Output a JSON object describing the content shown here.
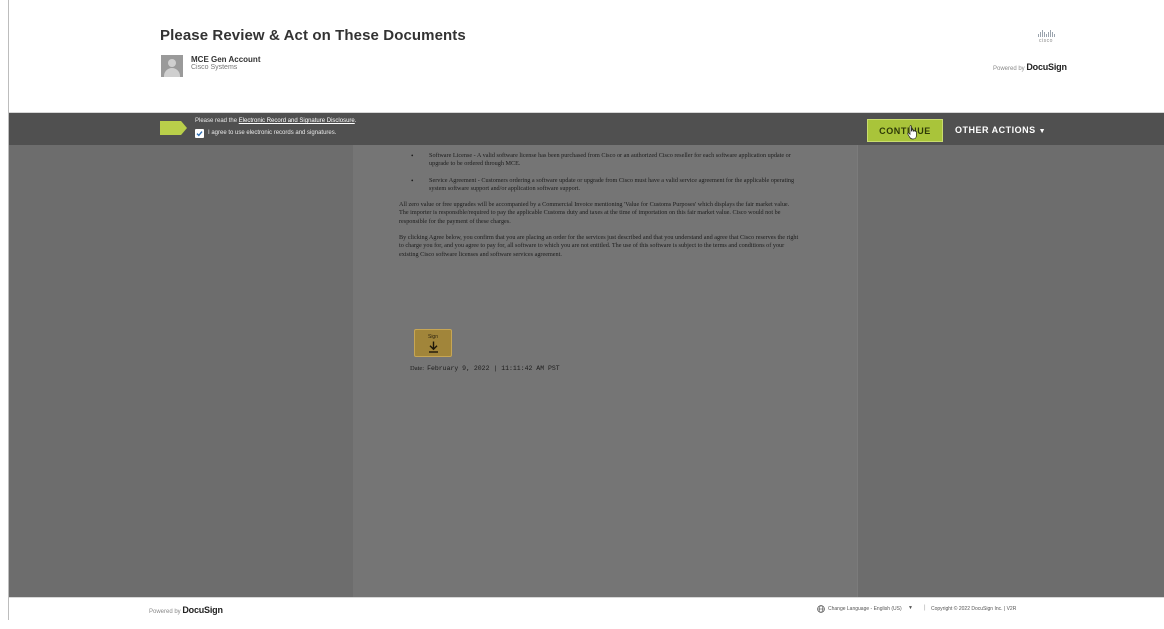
{
  "header": {
    "title": "Please Review & Act on These Documents",
    "sender_name": "MCE Gen Account",
    "sender_company": "Cisco Systems",
    "cisco_logo_text": "cisco",
    "powered_by_label": "Powered by",
    "brand": "DocuSign"
  },
  "action_bar": {
    "disclosure_prefix": "Please read the ",
    "disclosure_link": "Electronic Record and Signature Disclosure",
    "disclosure_suffix": ".",
    "agree_label": "I agree to use electronic records and signatures.",
    "agree_checked": true,
    "continue_label": "CONTINUE",
    "other_actions_label": "OTHER ACTIONS",
    "accent_color": "#a9c43a"
  },
  "document": {
    "bullets": [
      "Software License - A valid software license has been purchased from Cisco or an authorized Cisco reseller for each software application update or upgrade to be ordered through MCE.",
      "Service Agreement - Customers ordering a software update or upgrade from Cisco must have a valid service agreement for the applicable operating system software support and/or application software support."
    ],
    "paragraphs": [
      "All zero value or free upgrades will be accompanied by a Commercial Invoice mentioning 'Value for Customs Purposes' which displays the fair market value. The importer is responsible/required to pay the applicable Customs duty and taxes at the time of importation on this fair market value. Cisco would not be responsible for the payment of these charges.",
      "By clicking Agree below, you confirm that you are placing an order for the services just described and that you understand and agree that Cisco reserves the right to charge you for, and you agree to pay for, all software to which you are not entitled. The use of this software is subject to the terms and conditions of your existing Cisco software licenses and software services agreement."
    ],
    "sign_label": "Sign",
    "date_label": "Date:",
    "date_value": "February 9, 2022 | 11:11:42 AM PST"
  },
  "footer": {
    "powered_by_label": "Powered by",
    "brand": "DocuSign",
    "change_language": "Change Language - English (US)",
    "separator": "|",
    "copyright": "Copyright © 2022 DocuSign Inc. | V2R"
  }
}
